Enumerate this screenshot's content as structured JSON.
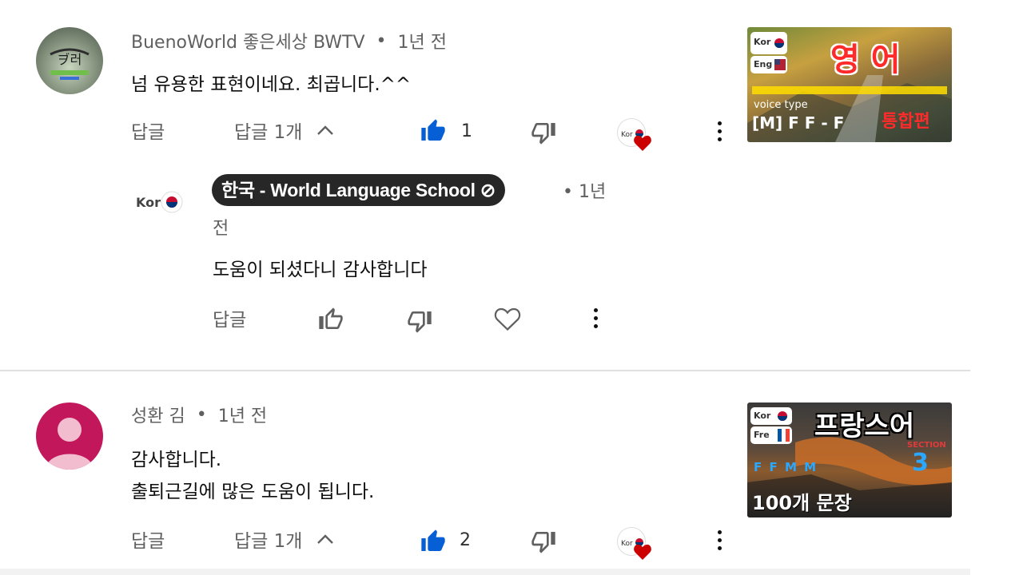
{
  "comments": [
    {
      "author": "BuenoWorld 좋은세상 BWTV",
      "time": "1년 전",
      "lines": [
        "넘 유용한 표현이네요. 최곱니다.^^"
      ],
      "reply_label": "답글",
      "replies_toggle": "답글 1개",
      "like_count": "1",
      "thumbnail": {
        "badge1": "Kor",
        "badge2": "Eng",
        "title": "영 어",
        "subtitle": "voice type",
        "voice": "[M] F F - F",
        "tag": "통합편",
        "accent": "#e60000"
      }
    },
    {
      "author": "성환 김",
      "time": "1년 전",
      "lines": [
        "감사합니다.",
        "출퇴근길에 많은 도움이 됩니다."
      ],
      "reply_label": "답글",
      "replies_toggle": "답글 1개",
      "like_count": "2",
      "thumbnail": {
        "badge1": "Kor",
        "badge2": "Fre",
        "title": "프랑스어",
        "section_label": "SECTION",
        "section_num": "3",
        "voice": "F F M M",
        "subtitle": "100개 문장"
      }
    }
  ],
  "reply": {
    "author": "한국 - World Language School ⊘",
    "time_line1": "• 1년",
    "time_line2": "전",
    "text": "도움이 되셨다니 감사합니다",
    "reply_label": "답글",
    "avatar_text": "Kor"
  },
  "colors": {
    "like_active": "#065fd4",
    "heart": "#cc0000",
    "avatar_pink": "#c2185b"
  }
}
